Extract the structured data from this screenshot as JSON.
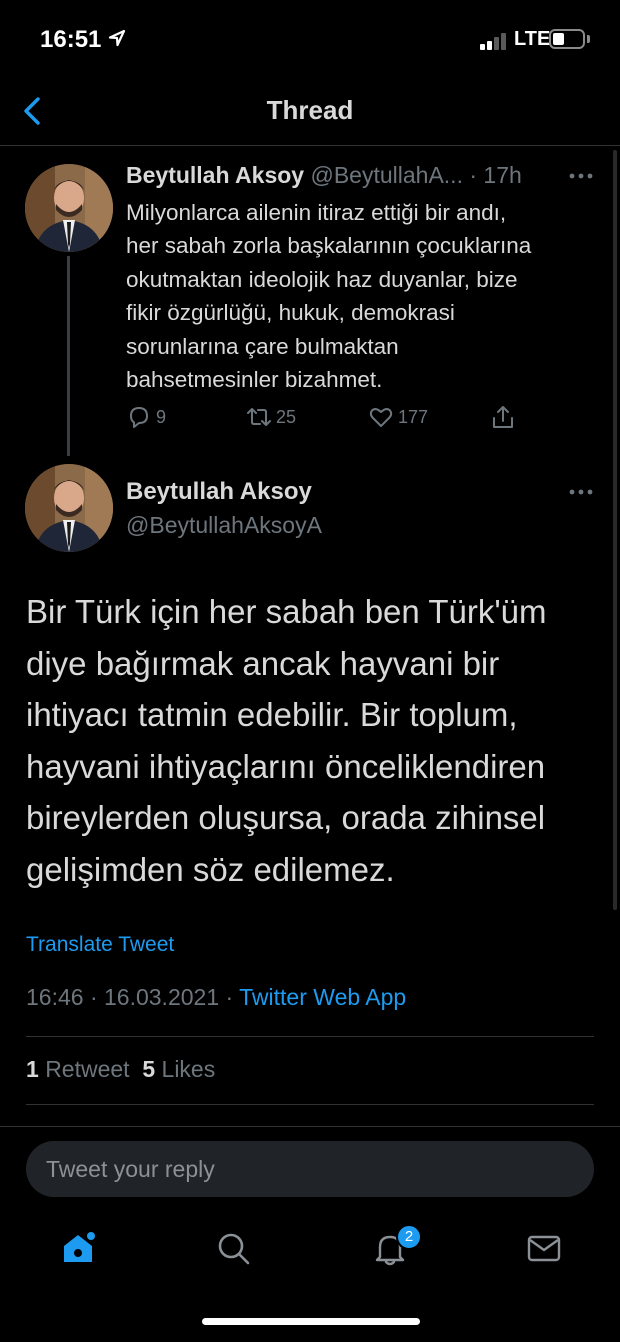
{
  "status_bar": {
    "time": "16:51",
    "network": "LTE"
  },
  "nav": {
    "title": "Thread"
  },
  "parent_tweet": {
    "name": "Beytullah Aksoy",
    "handle": "@BeytullahA...",
    "time": "· 17h",
    "text_lines": [
      "Milyonlarca ailenin itiraz ettiği bir andı,",
      "her sabah zorla başkalarının çocuklarına",
      "okutmaktan ideolojik haz duyanlar, bize",
      "fikir özgürlüğü, hukuk, demokrasi",
      "sorunlarına çare bulmaktan",
      "bahsetmesinler bizahmet."
    ],
    "replies": "9",
    "retweets": "25",
    "likes": "177"
  },
  "main_tweet": {
    "name": "Beytullah Aksoy",
    "handle": "@BeytullahAksoyA",
    "text_lines": [
      "Bir Türk için her sabah ben Türk'üm",
      "diye bağırmak ancak hayvani bir",
      "ihtiyacı tatmin edebilir. Bir toplum,",
      "hayvani ihtiyaçlarını önceliklendiren",
      "bireylerden oluşursa, orada zihinsel",
      "gelişimden söz edilemez."
    ],
    "translate_label": "Translate Tweet",
    "timestamp": "16:46 · 16.03.2021 ·",
    "source_app": "Twitter Web App",
    "retweet_count": "1",
    "retweet_label": "Retweet",
    "like_count": "5",
    "like_label": "Likes"
  },
  "reply": {
    "placeholder": "Tweet your reply"
  },
  "tabbar": {
    "notification_badge": "2"
  },
  "colors": {
    "accent": "#1d9bf0",
    "background": "#000000",
    "secondary_text": "#6e767d",
    "primary_text": "#d9d9d9"
  }
}
